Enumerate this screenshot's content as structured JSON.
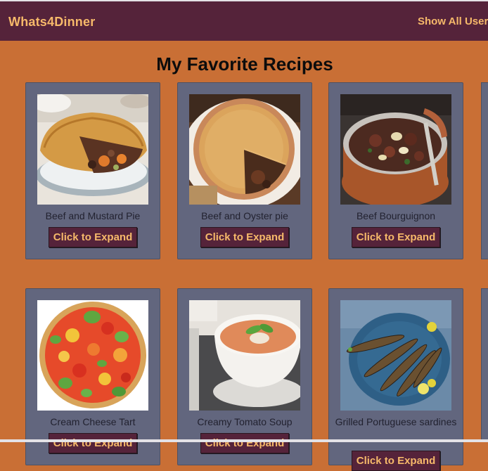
{
  "app": {
    "brand": "Whats4Dinner",
    "nav_link": "Show All Users"
  },
  "page": {
    "title": "My Favorite Recipes"
  },
  "recipes": [
    {
      "name": "Beef and Mustard Pie",
      "button": "Click to Expand",
      "image": "beef-mustard-pie-photo"
    },
    {
      "name": "Beef and Oyster pie",
      "button": "Click to Expand",
      "image": "beef-oyster-pie-photo"
    },
    {
      "name": "Beef Bourguignon",
      "button": "Click to Expand",
      "image": "beef-bourguignon-photo"
    },
    {
      "name": "Cream Cheese Tart",
      "button": "Click to Expand",
      "image": "cream-cheese-tart-photo"
    },
    {
      "name": "Creamy Tomato Soup",
      "button": "Click to Expand",
      "image": "creamy-tomato-soup-photo"
    },
    {
      "name": "Grilled Portuguese sardines",
      "button": "Click to Expand",
      "image": "grilled-sardines-photo"
    }
  ],
  "colors": {
    "navbar": "#55233a",
    "accent": "#f6b96a",
    "background": "#c96f35",
    "card": "#62667e"
  }
}
